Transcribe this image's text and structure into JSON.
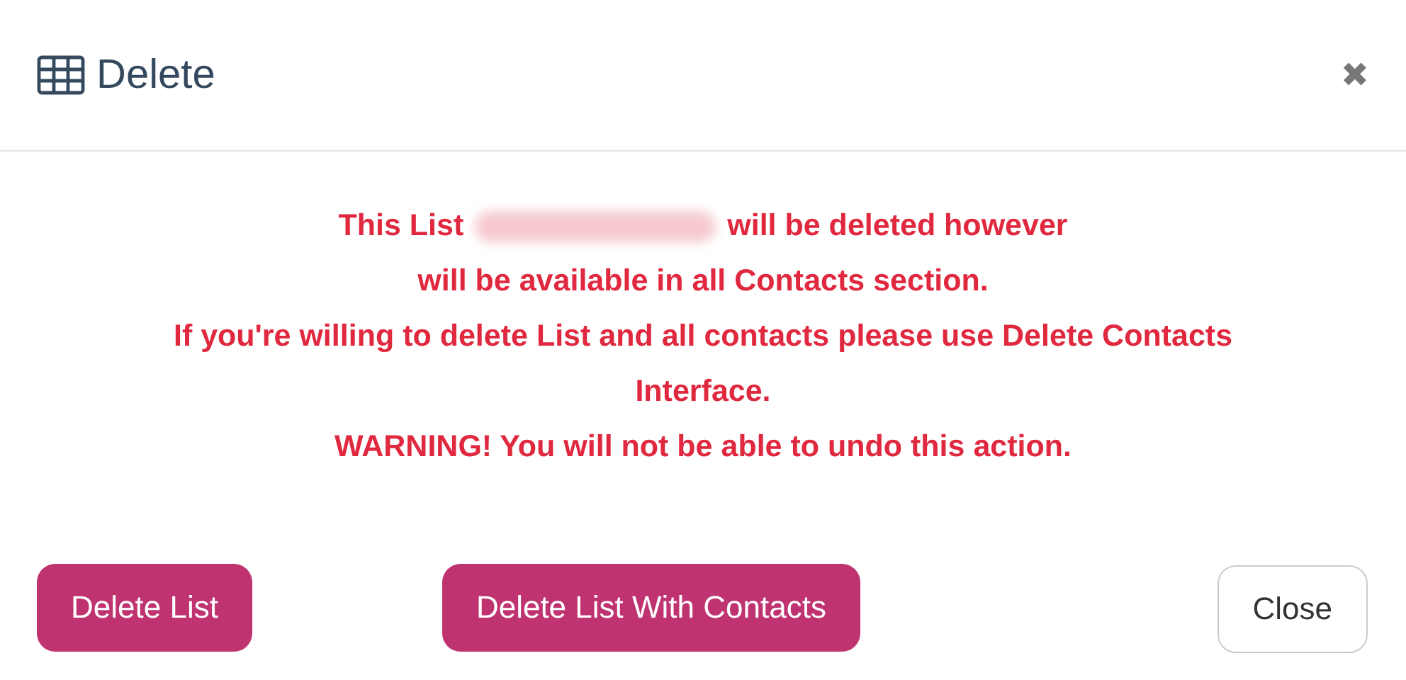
{
  "dialog": {
    "title": "Delete",
    "message": {
      "first_line": {
        "before": "This List",
        "after": "will be deleted however",
        "redacted": true
      },
      "lines": [
        "will be available in all Contacts section.",
        "If you're willing to delete List and all contacts please use Delete Contacts Interface.",
        "WARNING! You will not be able to undo this action."
      ]
    },
    "close_icon": "✖",
    "buttons": [
      {
        "label": "Delete List",
        "kind": "primary"
      },
      {
        "label": "Delete List With Contacts",
        "kind": "primary"
      },
      {
        "label": "Close",
        "kind": "secondary"
      }
    ]
  }
}
